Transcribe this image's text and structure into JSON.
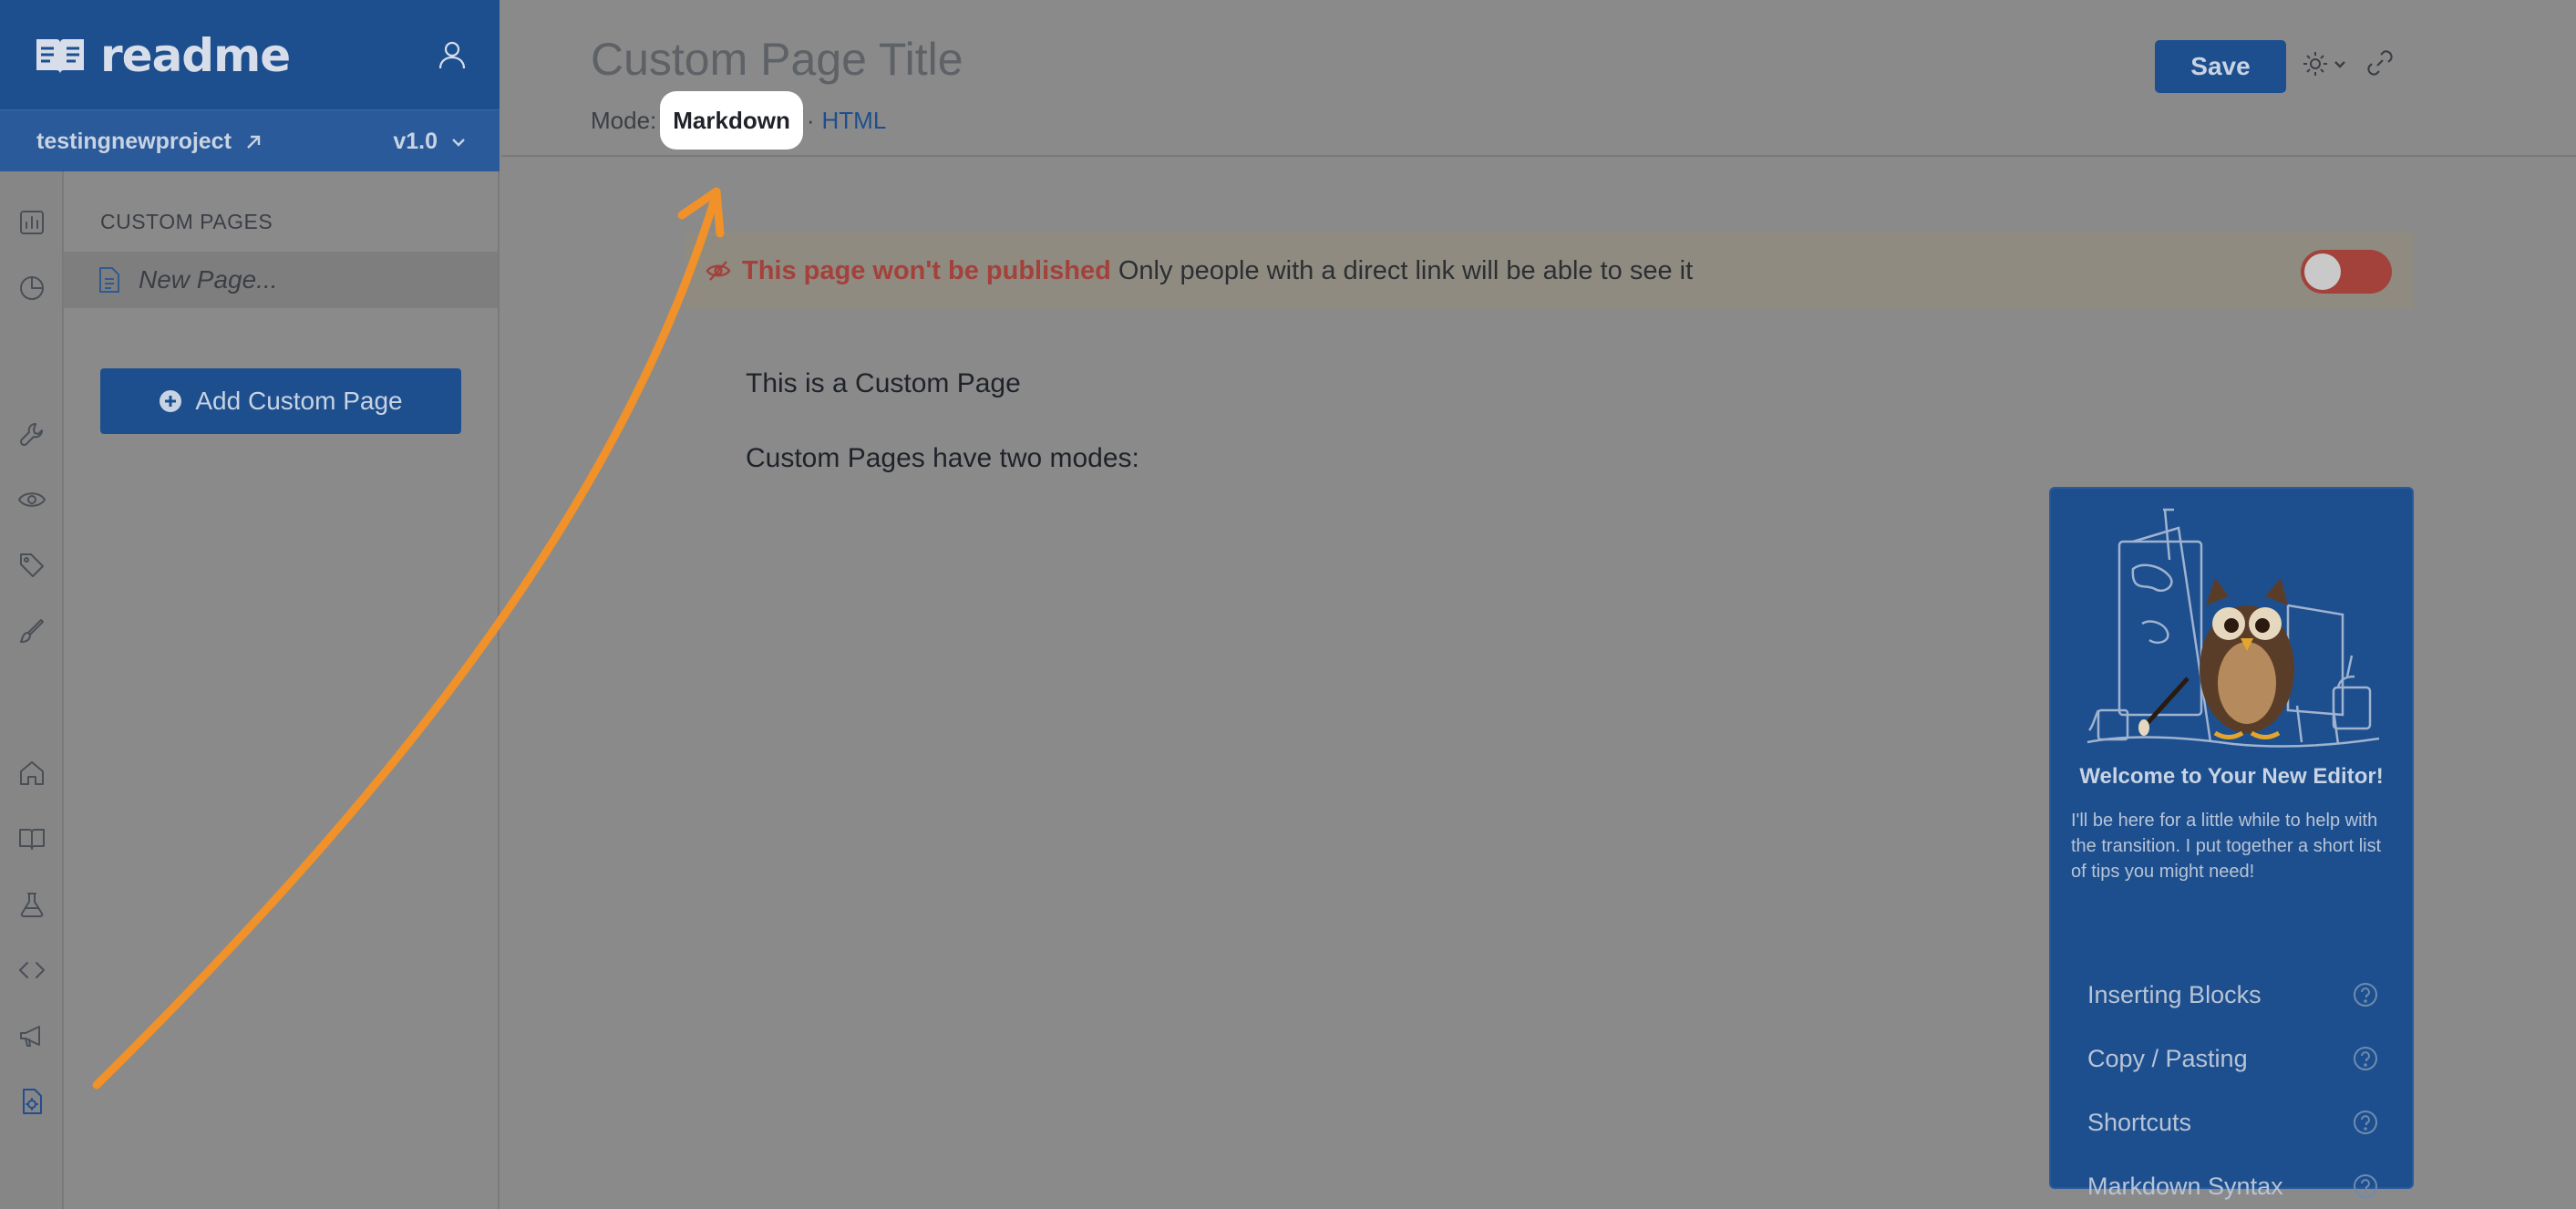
{
  "brand": {
    "logo_text": "readme"
  },
  "project": {
    "name": "testingnewproject",
    "version": "v1.0"
  },
  "sidebar": {
    "section_title": "CUSTOM PAGES",
    "pages": [
      "New Page..."
    ],
    "add_button_label": "Add Custom Page"
  },
  "rail_icons": [
    "chart-icon",
    "pie-chart-icon",
    "wrench-icon",
    "eye-icon",
    "tag-icon",
    "paint-icon",
    "home-icon",
    "book-icon",
    "flask-icon",
    "code-icon",
    "megaphone-icon",
    "custom-page-icon"
  ],
  "header": {
    "title_placeholder": "Custom Page Title",
    "mode_label": "Mode:",
    "mode_markdown": "Markdown",
    "mode_separator": "·",
    "mode_html": "HTML",
    "save_label": "Save"
  },
  "banner": {
    "warning": "This page won't be published",
    "message": "Only people with a direct link will be able to see it",
    "toggle_on": false
  },
  "content": {
    "line1": "This is a Custom Page",
    "line2": "Custom Pages have two modes:"
  },
  "welcome": {
    "title": "Welcome to Your New Editor!",
    "text": "I'll be here for a little while to help with the transition. I put together a short list of tips you might need!",
    "tips": [
      "Inserting Blocks",
      "Copy / Pasting",
      "Shortcuts",
      "Markdown Syntax"
    ]
  },
  "colors": {
    "brand": "#1d4f8e",
    "arrow": "#f0912a",
    "warning": "#a3413b",
    "overlay": "#8a8a8a"
  }
}
